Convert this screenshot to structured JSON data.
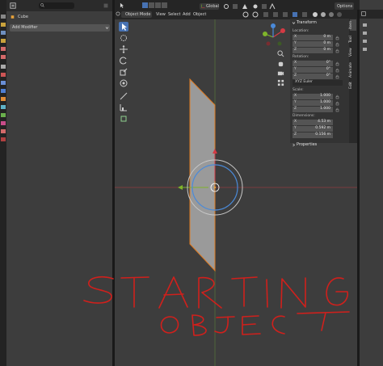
{
  "properties": {
    "object_name": "Cube",
    "add_modifier_label": "Add Modifier"
  },
  "header": {
    "mode_label": "Object Mode",
    "menus": [
      "View",
      "Select",
      "Add",
      "Object"
    ],
    "orientation_label": "Global",
    "options_label": "Options"
  },
  "sidebar": {
    "title": "Transform",
    "location": {
      "label": "Location:",
      "x": "0 m",
      "y": "0 m",
      "z": "0 m"
    },
    "rotation": {
      "label": "Rotation:",
      "x": "0°",
      "y": "0°",
      "z": "0°",
      "mode": "XYZ Euler"
    },
    "scale": {
      "label": "Scale:",
      "x": "1.000",
      "y": "1.000",
      "z": "1.000"
    },
    "dimensions": {
      "label": "Dimensions:",
      "x": "4.53 m",
      "y": "0.592 m",
      "z": "0.156 m"
    },
    "properties_title": "Properties",
    "tabs": [
      "Item",
      "Tool",
      "View",
      "Animate",
      "Edit"
    ]
  },
  "annotation": {
    "line1": "STARTING",
    "line2": "OBJECT",
    "color": "#d0201c"
  },
  "colors": {
    "selection_outline": "#e07a1f",
    "axis_red": "#d43a44",
    "axis_green": "#7fb42a",
    "gizmo_blue": "#4a8ad9",
    "accent": "#4772b3"
  }
}
